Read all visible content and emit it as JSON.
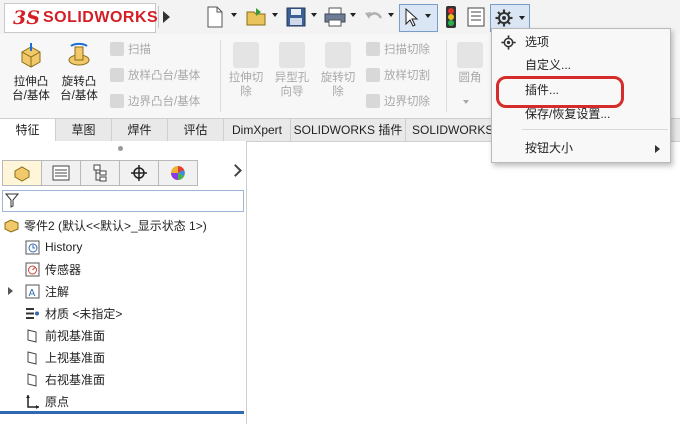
{
  "app": {
    "logo_prefix": "3S",
    "logo_name": "SOLIDWORKS"
  },
  "ribbon": {
    "extrude_boss": "拉伸凸台/基体",
    "revolve_boss": "旋转凸台/基体",
    "sweep": "扫描",
    "loft_boss": "放样凸台/基体",
    "boundary_boss": "边界凸台/基体",
    "extrude_cut": "拉伸切除",
    "hole_wizard": "异型孔向导",
    "revolve_cut": "旋转切除",
    "swept_cut": "扫描切除",
    "lofted_cut": "放样切割",
    "boundary_cut": "边界切除",
    "fillet": "圆角"
  },
  "tabs": [
    "特征",
    "草图",
    "焊件",
    "评估",
    "DimXpert",
    "SOLIDWORKS 插件",
    "SOLIDWORKS M"
  ],
  "tree": {
    "part": "零件2  (默认<<默认>_显示状态 1>)",
    "history": "History",
    "sensors": "传感器",
    "annotations": "注解",
    "material": "材质 <未指定>",
    "front_plane": "前视基准面",
    "top_plane": "上视基准面",
    "right_plane": "右视基准面",
    "origin": "原点"
  },
  "menu": {
    "options": "选项",
    "customize": "自定义...",
    "addins": "插件...",
    "save_restore": "保存/恢复设置...",
    "button_size": "按钮大小"
  },
  "colors": {
    "brand_red": "#d32027",
    "highlight_ring": "#d52b2b",
    "accent_blue": "#2f68b3"
  }
}
